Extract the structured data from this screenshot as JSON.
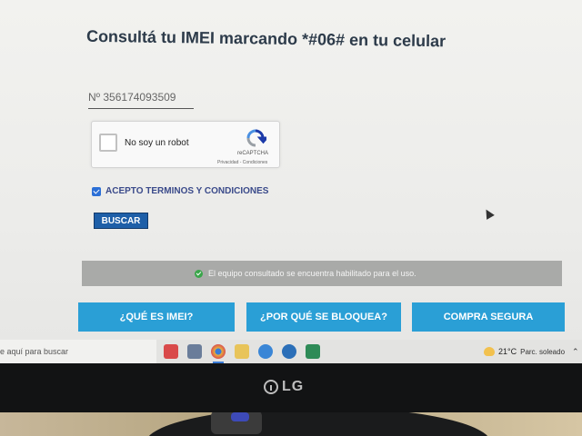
{
  "page": {
    "title": "Consultá tu IMEI marcando *#06# en tu celular",
    "imei_value": "Nº 356174093509",
    "captcha": {
      "label": "No soy un robot",
      "brand": "reCAPTCHA",
      "links": "Privacidad - Condiciones"
    },
    "terms_label": "ACEPTO TERMINOS Y CONDICIONES",
    "search_button": "BUSCAR",
    "status_message": "El equipo consultado se encuentra habilitado para el uso.",
    "buttons": [
      {
        "label": "¿QUÉ ES IMEI?"
      },
      {
        "label": "¿POR QUÉ SE BLOQUEA?"
      },
      {
        "label": "COMPRA SEGURA"
      }
    ]
  },
  "taskbar": {
    "search_placeholder": "e aquí para buscar",
    "apps": [
      {
        "icon": "app-red-icon",
        "color": "#d94a4a"
      },
      {
        "icon": "calculator-icon",
        "color": "#6a7d9a"
      },
      {
        "icon": "chrome-icon",
        "color": "#e8b23a"
      },
      {
        "icon": "folder-icon",
        "color": "#e8c45a"
      },
      {
        "icon": "clock-icon",
        "color": "#3a86d6"
      },
      {
        "icon": "cloud-icon",
        "color": "#2b6fb8"
      },
      {
        "icon": "excel-icon",
        "color": "#2e8b57"
      }
    ],
    "weather_temp": "21°C",
    "weather_desc": "Parc. soleado"
  },
  "monitor_brand": "LG",
  "colors": {
    "accent_blue": "#2a9fd6",
    "title_color": "#2d3b4a",
    "status_ok": "#3aa64a"
  }
}
